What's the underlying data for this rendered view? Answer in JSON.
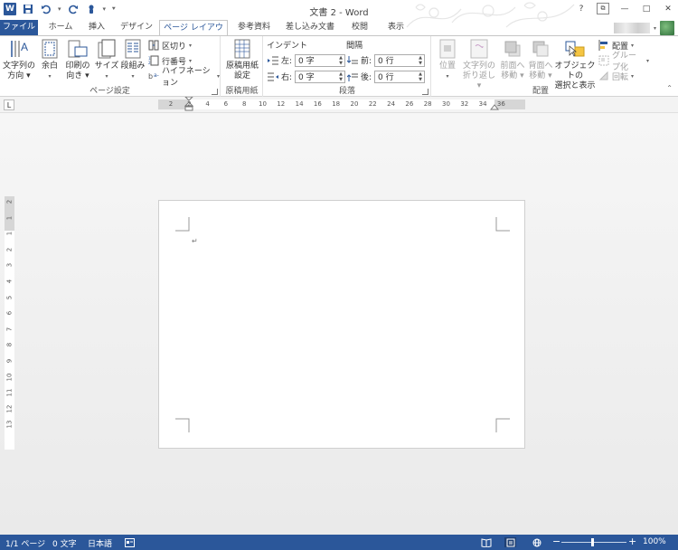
{
  "title_bar": {
    "logo": "W",
    "doc_title": "文書 2 - Word",
    "help": "?",
    "restore_ribbon": "⧉",
    "minimize": "—",
    "maximize": "□",
    "close": "✕"
  },
  "tabs": [
    {
      "label": "ファイル"
    },
    {
      "label": "ホーム"
    },
    {
      "label": "挿入"
    },
    {
      "label": "デザイン"
    },
    {
      "label": "ページ レイアウト"
    },
    {
      "label": "参考資料"
    },
    {
      "label": "差し込み文書"
    },
    {
      "label": "校閲"
    },
    {
      "label": "表示"
    }
  ],
  "active_tab": "ページ レイアウト",
  "ribbon": {
    "page_setup": {
      "label": "ページ設定",
      "text_direction": [
        "文字列の",
        "方向 ▾"
      ],
      "margins": "余白",
      "orientation": [
        "印刷の",
        "向き ▾"
      ],
      "size": "サイズ",
      "columns": "段組み",
      "breaks": "区切り",
      "line_numbers": "行番号",
      "hyphenation": "ハイフネーション"
    },
    "manuscript": {
      "label": "原稿用紙",
      "button": [
        "原稿用紙",
        "設定"
      ]
    },
    "paragraph": {
      "label": "段落",
      "indent_title": "インデント",
      "spacing_title": "間隔",
      "indent_left_label": "左:",
      "indent_left_value": "0 字",
      "indent_right_label": "右:",
      "indent_right_value": "0 字",
      "spacing_before_label": "前:",
      "spacing_before_value": "0 行",
      "spacing_after_label": "後:",
      "spacing_after_value": "0 行"
    },
    "arrange": {
      "label": "配置",
      "position": "位置",
      "wrap_text": [
        "文字列の",
        "折り返し ▾"
      ],
      "bring_forward": [
        "前面へ",
        "移動 ▾"
      ],
      "send_backward": [
        "背面へ",
        "移動 ▾"
      ],
      "selection_pane": [
        "オブジェクトの",
        "選択と表示"
      ],
      "align": "配置",
      "group": "グループ化",
      "rotate": "回転"
    }
  },
  "ruler": {
    "tab_selector": "L",
    "h_numbers": [
      "2",
      "2",
      "4",
      "6",
      "8",
      "10",
      "12",
      "14",
      "16",
      "18",
      "20",
      "22",
      "24",
      "26",
      "28",
      "30",
      "32",
      "34",
      "36"
    ],
    "v_numbers": [
      "2",
      "1",
      "1",
      "2",
      "3",
      "4",
      "5",
      "6",
      "7",
      "8",
      "9",
      "10",
      "11",
      "12",
      "13"
    ]
  },
  "document": {
    "paragraph_mark": "↵"
  },
  "status": {
    "page": "1/1 ページ",
    "words": "0 文字",
    "language": "日本語",
    "zoom_minus": "−",
    "zoom_plus": "+",
    "zoom": "100%"
  },
  "colors": {
    "accent": "#2b579a",
    "ribbon_border": "#c6c6c6",
    "doc_background": "#eeeeee"
  }
}
